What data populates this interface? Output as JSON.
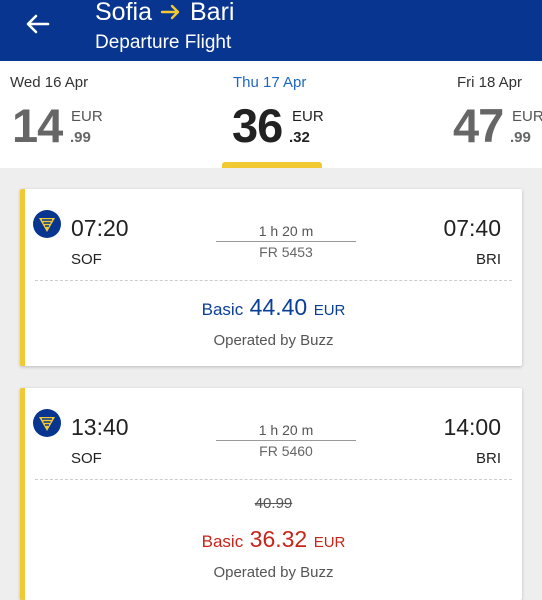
{
  "header": {
    "origin": "Sofia",
    "destination": "Bari",
    "subtitle": "Departure Flight",
    "icons": [
      "back-arrow-icon",
      "route-arrow-icon"
    ],
    "accent_color": "#f1c933",
    "bg_color": "#073590"
  },
  "dates": [
    {
      "label": "Wed 16 Apr",
      "price_int": "14",
      "currency": "EUR",
      "price_dec": ".99",
      "selected": false
    },
    {
      "label": "Thu 17 Apr",
      "price_int": "36",
      "currency": "EUR",
      "price_dec": ".32",
      "selected": true
    },
    {
      "label": "Fri 18 Apr",
      "price_int": "47",
      "currency": "EUR",
      "price_dec": ".99",
      "selected": false
    }
  ],
  "flights": [
    {
      "dep_time": "07:20",
      "dep_code": "SOF",
      "arr_time": "07:40",
      "arr_code": "BRI",
      "duration": "1 h 20 m",
      "flight_no": "FR 5453",
      "fare_label": "Basic",
      "price": "44.40",
      "currency": "EUR",
      "old_price": "",
      "operator": "Operated by Buzz",
      "price_color": "#0a3f96"
    },
    {
      "dep_time": "13:40",
      "dep_code": "SOF",
      "arr_time": "14:00",
      "arr_code": "BRI",
      "duration": "1 h 20 m",
      "flight_no": "FR 5460",
      "fare_label": "Basic",
      "price": "36.32",
      "currency": "EUR",
      "old_price": "40.99",
      "operator": "Operated by Buzz",
      "price_color": "#c8251a"
    }
  ]
}
